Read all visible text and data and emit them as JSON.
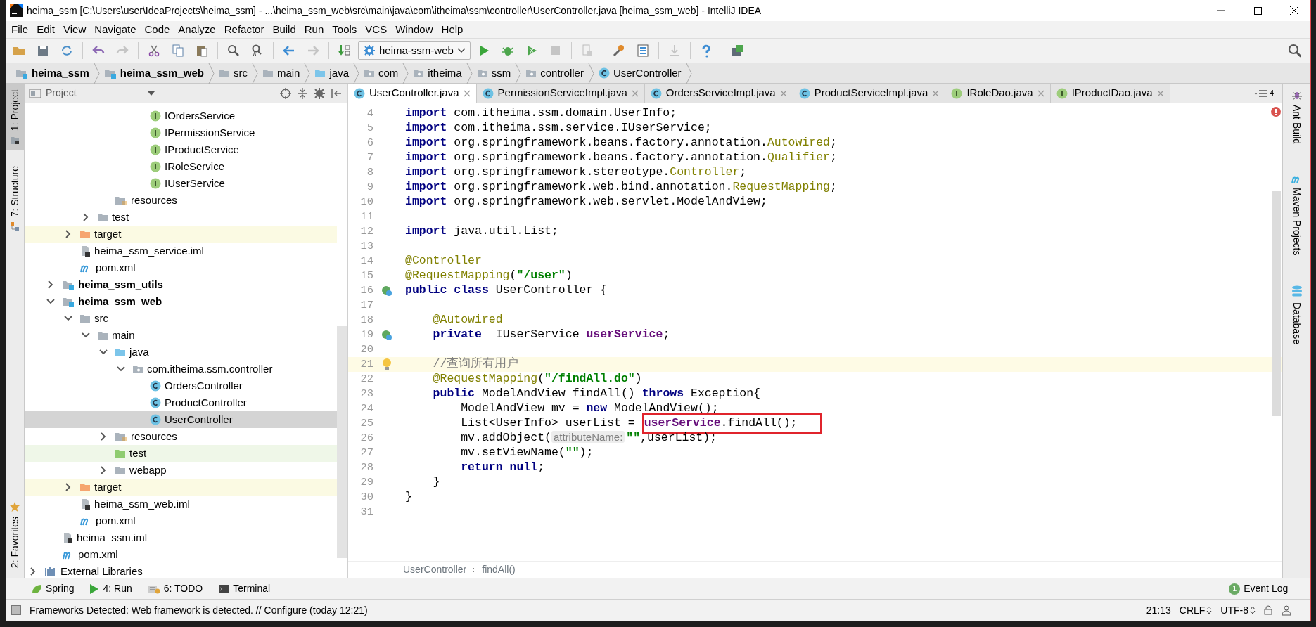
{
  "window": {
    "title": "heima_ssm [C:\\Users\\user\\IdeaProjects\\heima_ssm] - ...\\heima_ssm_web\\src\\main\\java\\com\\itheima\\ssm\\controller\\UserController.java [heima_ssm_web] - IntelliJ IDEA"
  },
  "menu": [
    "File",
    "Edit",
    "View",
    "Navigate",
    "Code",
    "Analyze",
    "Refactor",
    "Build",
    "Run",
    "Tools",
    "VCS",
    "Window",
    "Help"
  ],
  "toolbar": {
    "run_config": "heima-ssm-web"
  },
  "breadcrumbs": [
    {
      "label": "heima_ssm",
      "kind": "module"
    },
    {
      "label": "heima_ssm_web",
      "kind": "module"
    },
    {
      "label": "src",
      "kind": "folder"
    },
    {
      "label": "main",
      "kind": "folder"
    },
    {
      "label": "java",
      "kind": "source"
    },
    {
      "label": "com",
      "kind": "package"
    },
    {
      "label": "itheima",
      "kind": "package"
    },
    {
      "label": "ssm",
      "kind": "package"
    },
    {
      "label": "controller",
      "kind": "package"
    },
    {
      "label": "UserController",
      "kind": "class"
    }
  ],
  "left_stripe": [
    {
      "label": "1: Project",
      "selected": true
    },
    {
      "label": "7: Structure",
      "selected": false
    },
    {
      "label": "2: Favorites",
      "selected": false
    }
  ],
  "right_stripe": [
    {
      "label": "Ant Build",
      "kind": "ant"
    },
    {
      "label": "Maven Projects",
      "kind": "maven"
    },
    {
      "label": "Database",
      "kind": "database"
    }
  ],
  "project_panel": {
    "title": "Project"
  },
  "tree": [
    {
      "children": [
        {
          "children": [
            {
              "children": [
                {
                  "children": [
                    {
                      "children": [
                        {
                          "children": [
                            {
                              "label": "IOrdersService",
                              "kind": "interface",
                              "selected": false
                            },
                            {
                              "label": "IPermissionService",
                              "kind": "interface",
                              "selected": false
                            },
                            {
                              "label": "IProductService",
                              "kind": "interface",
                              "selected": false
                            },
                            {
                              "label": "IRoleService",
                              "kind": "interface",
                              "selected": false
                            },
                            {
                              "label": "IUserService",
                              "kind": "interface",
                              "selected": false
                            }
                          ]
                        }
                      ]
                    },
                    {
                      "label": "resources",
                      "kind": "resources",
                      "selected": false
                    }
                  ]
                },
                {
                  "label": "test",
                  "kind": "folder",
                  "expanded": false,
                  "selected": false
                }
              ]
            },
            {
              "label": "target",
              "kind": "excluded",
              "expanded": false,
              "selected": false
            },
            {
              "label": "heima_ssm_service.iml",
              "kind": "iml",
              "selected": false
            },
            {
              "label": "pom.xml",
              "kind": "maven",
              "selected": false
            }
          ]
        },
        {
          "label": "heima_ssm_utils",
          "kind": "module",
          "expanded": false,
          "selected": false
        },
        {
          "label": "heima_ssm_web",
          "kind": "module",
          "expanded": true,
          "selected": false,
          "children": [
            {
              "label": "src",
              "kind": "folder",
              "expanded": true,
              "selected": false,
              "children": [
                {
                  "label": "main",
                  "kind": "folder",
                  "expanded": true,
                  "selected": false,
                  "children": [
                    {
                      "label": "java",
                      "kind": "source",
                      "expanded": true,
                      "selected": false,
                      "children": [
                        {
                          "label": "com.itheima.ssm.controller",
                          "kind": "package",
                          "expanded": true,
                          "selected": false,
                          "children": [
                            {
                              "label": "OrdersController",
                              "kind": "class",
                              "selected": false
                            },
                            {
                              "label": "ProductController",
                              "kind": "class",
                              "selected": false
                            },
                            {
                              "label": "UserController",
                              "kind": "class",
                              "selected": true
                            }
                          ]
                        }
                      ]
                    },
                    {
                      "label": "resources",
                      "kind": "resources",
                      "expanded": false,
                      "selected": false
                    },
                    {
                      "label": "test",
                      "kind": "test",
                      "selected": false
                    },
                    {
                      "label": "webapp",
                      "kind": "folder",
                      "expanded": false,
                      "selected": false
                    }
                  ]
                }
              ]
            },
            {
              "label": "target",
              "kind": "excluded",
              "expanded": false,
              "selected": false
            },
            {
              "label": "heima_ssm_web.iml",
              "kind": "iml",
              "selected": false
            },
            {
              "label": "pom.xml",
              "kind": "maven",
              "selected": false
            }
          ]
        },
        {
          "label": "heima_ssm.iml",
          "kind": "iml",
          "selected": false
        },
        {
          "label": "pom.xml",
          "kind": "maven",
          "selected": false
        }
      ]
    },
    {
      "label": "External Libraries",
      "kind": "libraries",
      "expanded": false,
      "selected": false
    }
  ],
  "tabs": [
    {
      "label": "UserController.java",
      "kind": "class",
      "selected": true
    },
    {
      "label": "PermissionServiceImpl.java",
      "kind": "class",
      "selected": false
    },
    {
      "label": "OrdersServiceImpl.java",
      "kind": "class",
      "selected": false
    },
    {
      "label": "ProductServiceImpl.java",
      "kind": "class",
      "selected": false
    },
    {
      "label": "IRoleDao.java",
      "kind": "interface",
      "selected": false
    },
    {
      "label": "IProductDao.java",
      "kind": "interface",
      "selected": false
    }
  ],
  "hidden_tabs_count": "4",
  "code": [
    {
      "number": "4",
      "tokens": [
        {
          "kind": "keyword",
          "text": "import"
        },
        {
          "kind": "plain",
          "text": " com.itheima.ssm.domain.UserInfo;"
        }
      ]
    },
    {
      "number": "5",
      "tokens": [
        {
          "kind": "keyword",
          "text": "import"
        },
        {
          "kind": "plain",
          "text": " com.itheima.ssm.service.IUserService;"
        }
      ]
    },
    {
      "number": "6",
      "tokens": [
        {
          "kind": "keyword",
          "text": "import"
        },
        {
          "kind": "plain",
          "text": " org.springframework.beans.factory.annotation."
        },
        {
          "kind": "annotation",
          "text": "Autowired"
        },
        {
          "kind": "plain",
          "text": ";"
        }
      ]
    },
    {
      "number": "7",
      "tokens": [
        {
          "kind": "keyword",
          "text": "import"
        },
        {
          "kind": "plain",
          "text": " org.springframework.beans.factory.annotation."
        },
        {
          "kind": "annotation",
          "text": "Qualifier"
        },
        {
          "kind": "plain",
          "text": ";"
        }
      ]
    },
    {
      "number": "8",
      "tokens": [
        {
          "kind": "keyword",
          "text": "import"
        },
        {
          "kind": "plain",
          "text": " org.springframework.stereotype."
        },
        {
          "kind": "annotation",
          "text": "Controller"
        },
        {
          "kind": "plain",
          "text": ";"
        }
      ]
    },
    {
      "number": "9",
      "tokens": [
        {
          "kind": "keyword",
          "text": "import"
        },
        {
          "kind": "plain",
          "text": " org.springframework.web.bind.annotation."
        },
        {
          "kind": "annotation",
          "text": "RequestMapping"
        },
        {
          "kind": "plain",
          "text": ";"
        }
      ]
    },
    {
      "number": "10",
      "tokens": [
        {
          "kind": "keyword",
          "text": "import"
        },
        {
          "kind": "plain",
          "text": " org.springframework.web.servlet.ModelAndView;"
        }
      ]
    },
    {
      "number": "11"
    },
    {
      "number": "12",
      "tokens": [
        {
          "kind": "keyword",
          "text": "import"
        },
        {
          "kind": "plain",
          "text": " java.util.List;"
        }
      ]
    },
    {
      "number": "13"
    },
    {
      "number": "14",
      "tokens": [
        {
          "kind": "annotation",
          "text": "@Controller"
        }
      ]
    },
    {
      "number": "15",
      "tokens": [
        {
          "kind": "annotation",
          "text": "@RequestMapping"
        },
        {
          "kind": "plain",
          "text": "("
        },
        {
          "kind": "string",
          "text": "\"/user\""
        },
        {
          "kind": "plain",
          "text": ")"
        }
      ]
    },
    {
      "number": "16",
      "bean_marker": true,
      "tokens": [
        {
          "kind": "keyword",
          "text": "public class"
        },
        {
          "kind": "plain",
          "text": " UserController {"
        }
      ]
    },
    {
      "number": "17"
    },
    {
      "number": "18",
      "tokens": [
        {
          "kind": "annotation",
          "text": "    @Autowired"
        }
      ]
    },
    {
      "number": "19",
      "bean_marker": true,
      "tokens": [
        {
          "kind": "keyword",
          "text": "    private"
        },
        {
          "kind": "plain",
          "text": "  IUserService "
        },
        {
          "kind": "field",
          "text": "userService"
        },
        {
          "kind": "plain",
          "text": ";"
        }
      ]
    },
    {
      "number": "20"
    },
    {
      "number": "21",
      "current": true,
      "bulb_marker": true,
      "tokens": [
        {
          "kind": "comment",
          "text": "    //查询所有用户"
        }
      ]
    },
    {
      "number": "22",
      "tokens": [
        {
          "kind": "annotation",
          "text": "    @RequestMapping"
        },
        {
          "kind": "plain",
          "text": "("
        },
        {
          "kind": "string",
          "text": "\"/findAll.do\""
        },
        {
          "kind": "plain",
          "text": ")"
        }
      ]
    },
    {
      "number": "23",
      "tokens": [
        {
          "kind": "keyword",
          "text": "    public"
        },
        {
          "kind": "plain",
          "text": " ModelAndView findAll() "
        },
        {
          "kind": "keyword",
          "text": "throws"
        },
        {
          "kind": "plain",
          "text": " Exception{"
        }
      ]
    },
    {
      "number": "24",
      "tokens": [
        {
          "kind": "plain",
          "text": "        ModelAndView mv = "
        },
        {
          "kind": "keyword",
          "text": "new"
        },
        {
          "kind": "plain",
          "text": " ModelAndView();"
        }
      ]
    },
    {
      "number": "25",
      "tokens": [
        {
          "kind": "plain",
          "text": "        List<UserInfo> userList = "
        }
      ],
      "boxed": [
        {
          "kind": "field",
          "text": "userService"
        },
        {
          "kind": "plain",
          "text": ".findAll();"
        }
      ]
    },
    {
      "number": "26",
      "tokens": [
        {
          "kind": "plain",
          "text": "        mv.addObject("
        },
        {
          "kind": "hint",
          "text": "attributeName:"
        },
        {
          "kind": "string",
          "text": "\"\""
        },
        {
          "kind": "plain",
          "text": ",userList);"
        }
      ]
    },
    {
      "number": "27",
      "tokens": [
        {
          "kind": "plain",
          "text": "        mv.setViewName("
        },
        {
          "kind": "string",
          "text": "\"\""
        },
        {
          "kind": "plain",
          "text": ");"
        }
      ]
    },
    {
      "number": "28",
      "tokens": [
        {
          "kind": "keyword",
          "text": "        return null"
        },
        {
          "kind": "plain",
          "text": ";"
        }
      ]
    },
    {
      "number": "29",
      "tokens": [
        {
          "kind": "plain",
          "text": "    }"
        }
      ]
    },
    {
      "number": "30",
      "tokens": [
        {
          "kind": "plain",
          "text": "}"
        }
      ]
    },
    {
      "number": "31"
    }
  ],
  "editor_breadcrumbs": [
    "UserController",
    "findAll()"
  ],
  "tool_buttons": [
    {
      "label": "Spring",
      "kind": "spring"
    },
    {
      "label": "4: Run",
      "kind": "run"
    },
    {
      "label": "6: TODO",
      "kind": "todo"
    },
    {
      "label": "Terminal",
      "kind": "terminal"
    }
  ],
  "event_log": {
    "label": "Event Log",
    "count": "1"
  },
  "status_bar": {
    "message": "Frameworks Detected: Web framework is detected. // Configure (today 12:21)",
    "position": "21:13",
    "line_separator": "CRLF",
    "encoding": "UTF-8"
  }
}
